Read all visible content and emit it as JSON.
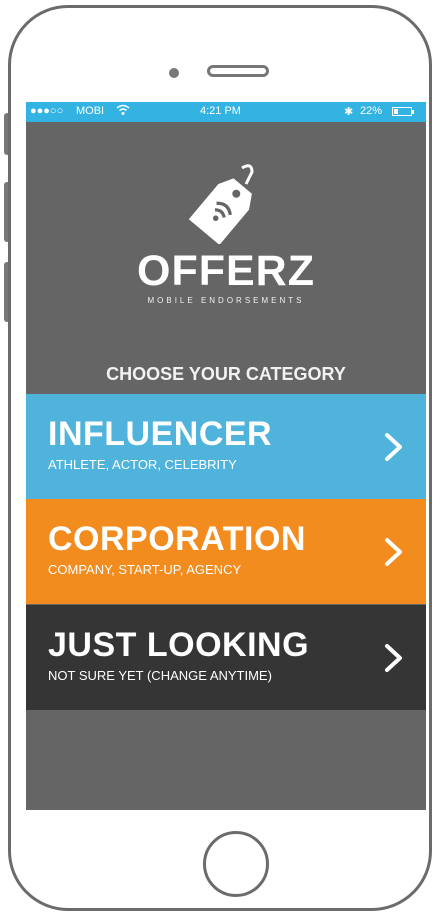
{
  "status_bar": {
    "signal": "●●●○○",
    "carrier": "MOBI",
    "time": "4:21 PM",
    "battery": "22%",
    "bluetooth": "✱"
  },
  "brand": {
    "name": "OFFERZ",
    "tagline": "MOBILE ENDORSEMENTS"
  },
  "heading": "CHOOSE YOUR CATEGORY",
  "categories": [
    {
      "title": "INFLUENCER",
      "subtitle": "ATHLETE, ACTOR, CELEBRITY",
      "color": "#4fb3dc"
    },
    {
      "title": "CORPORATION",
      "subtitle": "COMPANY, START-UP, AGENCY",
      "color": "#f28c1f"
    },
    {
      "title": "JUST LOOKING",
      "subtitle": "NOT SURE YET (CHANGE ANYTIME)",
      "color": "#353535"
    }
  ],
  "colors": {
    "screen_bg": "#656565",
    "status_bar": "#33b3e2"
  }
}
